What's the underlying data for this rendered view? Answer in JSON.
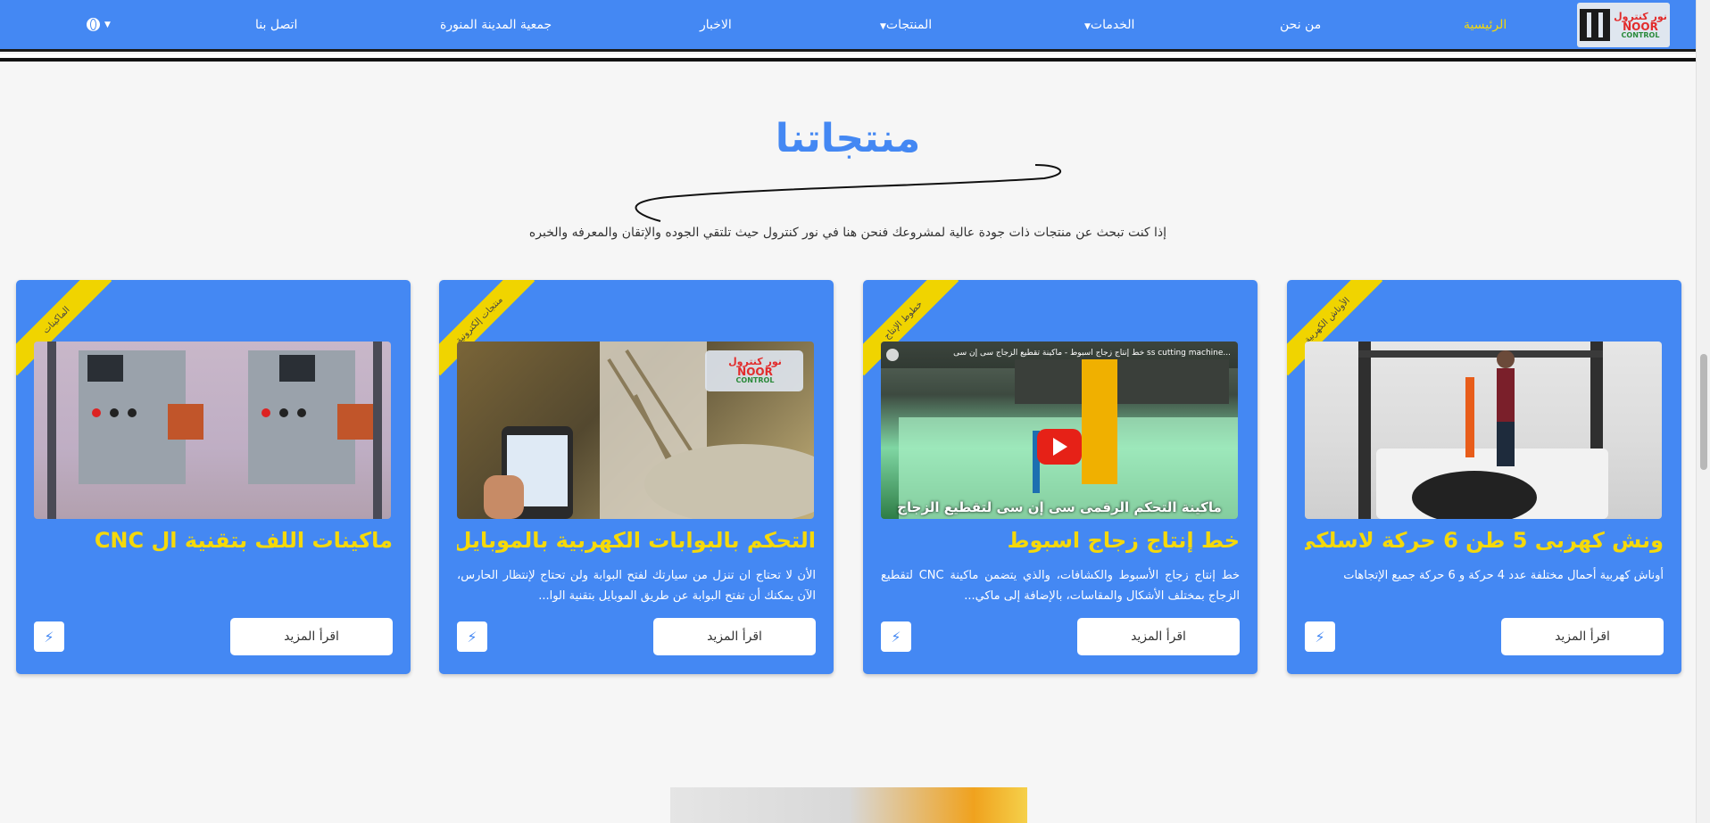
{
  "nav": {
    "logo_ar": "نور كنترول",
    "logo_en1": "NOOR",
    "logo_en2": "CONTROL",
    "items": [
      {
        "label": "الرئيسية"
      },
      {
        "label": "من نحن"
      },
      {
        "label": "الخدمات"
      },
      {
        "label": "المنتجات"
      },
      {
        "label": "الاخبار"
      },
      {
        "label": "جمعية المدينة المنورة"
      },
      {
        "label": "اتصل بنا"
      }
    ]
  },
  "section": {
    "title": "منتجاتنا",
    "subtitle": "إذا كنت تبحث عن منتجات ذات جودة عالية لمشروعك فنحن هنا في نور كنترول حيث تلتقي الجوده والإتقان والمعرفه والخبره"
  },
  "cards": [
    {
      "ribbon": "الأوناش الكهربية",
      "title": "ونش كهربى 5 طن 6 حركة لاسلكى...",
      "desc": "أوناش كهربية أحمال مختلفة عدد 4 حركة و 6 حركة جميع الإتجاهات",
      "button": "اقرأ المزيد",
      "icon": "bolt-icon"
    },
    {
      "ribbon": "خطوط الإنتاج",
      "title": "خط إنتاج زجاج اسبوط",
      "desc": "خط إنتاج زجاج الأسبوط والكشافات، والذي يتضمن ماكينة CNC لتقطيع الزجاج بمختلف الأشكال والمقاسات، بالإضافة إلى ماكي...",
      "video_caption": "ماكينة التحكم الرقمى سى إن سى لتقطيع الزجاج",
      "video_title": "...ss cutting machine خط إنتاج زجاج اسبوط - ماكينة تقطيع الزجاج سى إن سى",
      "button": "اقرأ المزيد",
      "icon": "bolt-icon"
    },
    {
      "ribbon": "منتجات إلكترونية",
      "title": "التحكم بالبوابات الكهربية بالموبايل...",
      "desc": "الأن لا تحتاج ان تنزل من سيارتك لفتح البوابة ولن تحتاج لإنتظار الحارس، الآن يمكنك أن تفتح البوابة عن طريق الموبايل بتقنية الوا...",
      "button": "اقرأ المزيد",
      "icon": "bolt-icon"
    },
    {
      "ribbon": "الماكينات",
      "title": "ماكينات اللف بتقنية ال CNC",
      "desc": "",
      "button": "اقرأ المزيد",
      "icon": "bolt-icon"
    }
  ],
  "colors": {
    "primary": "#4488f3",
    "accent": "#f5d90a",
    "ribbon": "#f0d400"
  }
}
